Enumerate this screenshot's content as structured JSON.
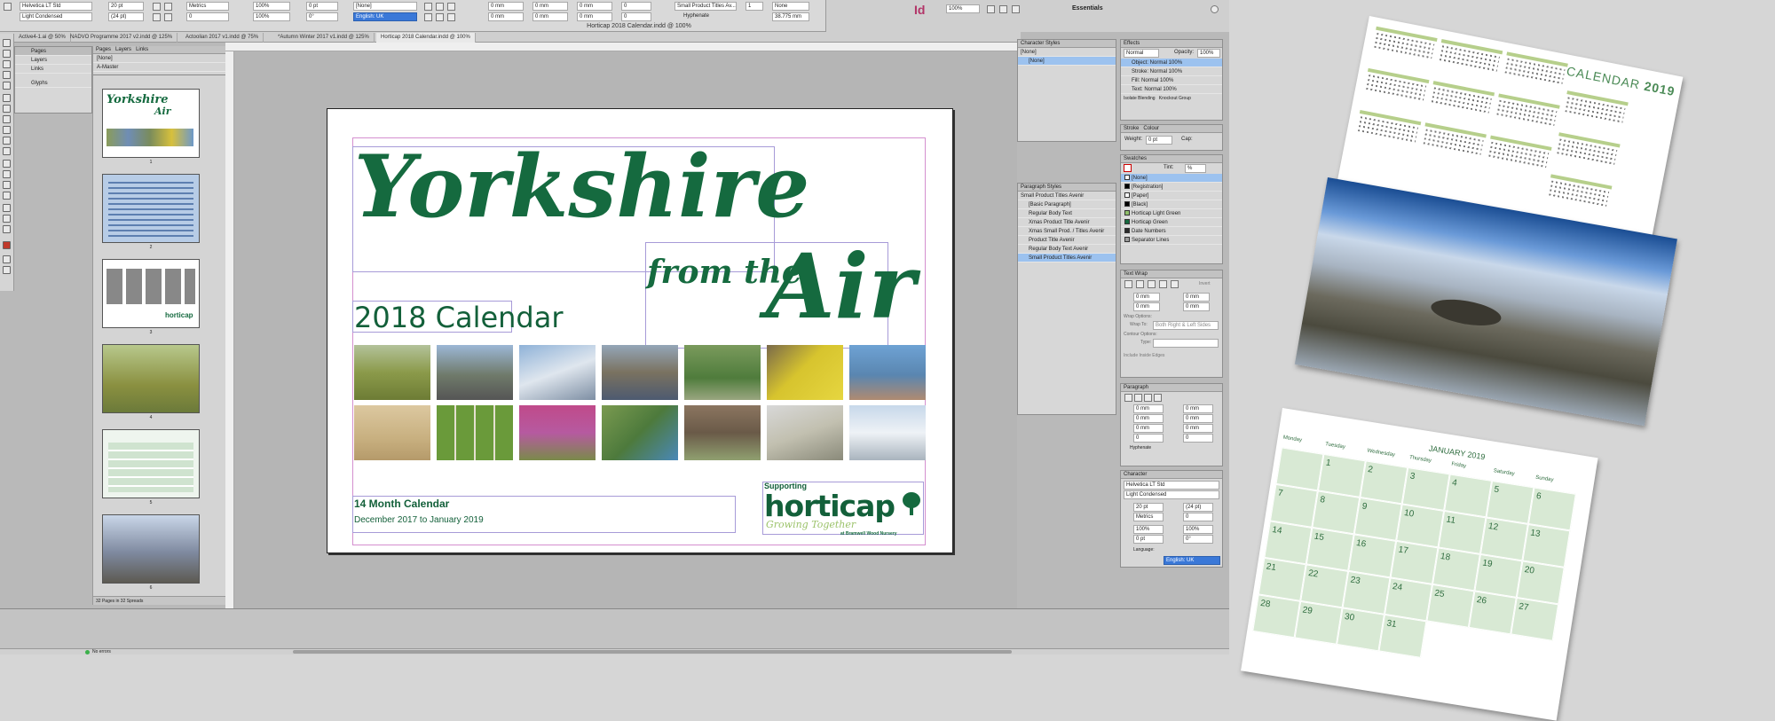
{
  "toolbar": {
    "font_family": "Helvetica LT Std",
    "font_style": "Light Condensed",
    "size": "20 pt",
    "leading": "(24 pt)",
    "tracking": "Metrics",
    "scale_h": "100%",
    "scale_v": "100%",
    "char_style": "[None]",
    "language": "English: UK",
    "paragraph_style": "Small Product Titles Av...",
    "hyphenate": "Hyphenate",
    "none": "None",
    "zoom": "100%",
    "workspace": "Essentials",
    "app_logo": "Id"
  },
  "window_title": "Horticap 2018 Calendar.indd @ 100%",
  "doc_tabs": [
    "Active4-1.ai @ 50%",
    "NADVO Programme 2017 v2.indd @ 125%",
    "Actoolian 2017 v1.indd @ 75%",
    "*Autumn Winter 2017 v1.indd @ 125%",
    "Horticap 2018 Calendar.indd @ 100%"
  ],
  "panels_left": {
    "items": [
      "Pages",
      "Layers",
      "Links",
      "Glyphs"
    ]
  },
  "pages_panel": {
    "tabs": [
      "Pages",
      "Layers",
      "Links"
    ],
    "none_label": "[None]",
    "master_label": "A-Master",
    "page_numbers": [
      "1",
      "2",
      "3",
      "4",
      "5",
      "6"
    ],
    "footer": "32 Pages in 32 Spreads"
  },
  "document": {
    "title_yorkshire": "Yorkshire",
    "title_from_the": "from the",
    "title_air": "Air",
    "subtitle": "2018 Calendar",
    "month_label": "14 Month Calendar",
    "date_range": "December 2017 to January 2019",
    "supporting": "Supporting",
    "logo": "horticap",
    "logo_tagline": "Growing Together",
    "logo_sub": "at Bramwell Wood Nursery"
  },
  "character_styles": {
    "title": "Character Styles",
    "rows": [
      "[None]",
      "[None]"
    ]
  },
  "paragraph_styles": {
    "title": "Paragraph Styles",
    "current": "Small Product Titles Avenir",
    "rows": [
      "[Basic Paragraph]",
      "Regular Body Text",
      "Xmas Product Title Avenir",
      "Xmas Small Prod. / Titles Avenir",
      "Product Title Avenir",
      "Regular Body Text Avenir",
      "Small Product Titles Avenir"
    ]
  },
  "effects": {
    "title": "Effects",
    "mode": "Normal",
    "opacity_label": "Opacity:",
    "opacity": "100%",
    "rows": [
      "Object: Normal 100%",
      "Stroke: Normal 100%",
      "Fill: Normal 100%",
      "Text: Normal 100%"
    ],
    "isolate": "Isolate Blending",
    "knockout": "Knockout Group"
  },
  "stroke": {
    "tabs": [
      "Stroke",
      "Colour"
    ],
    "weight_label": "Weight:",
    "weight": "0 pt",
    "cap_label": "Cap:"
  },
  "swatches": {
    "title": "Swatches",
    "tint_label": "Tint:",
    "tint": "%",
    "rows": [
      {
        "name": "[None]",
        "color": "#ffffff"
      },
      {
        "name": "[Registration]",
        "color": "#000000"
      },
      {
        "name": "[Paper]",
        "color": "#ffffff"
      },
      {
        "name": "[Black]",
        "color": "#000000"
      },
      {
        "name": "Horticap Light Green",
        "color": "#8fbf6a"
      },
      {
        "name": "Horticap Green",
        "color": "#156a3f"
      },
      {
        "name": "Date Numbers",
        "color": "#2a2a2a"
      },
      {
        "name": "Separator Lines",
        "color": "#9a9a9a"
      }
    ]
  },
  "text_wrap": {
    "title": "Text Wrap",
    "invert": "Invert",
    "value": "0 mm",
    "wrap_options": "Wrap Options:",
    "wrap_to_label": "Wrap To:",
    "wrap_to": "Both Right & Left Sides",
    "contour": "Contour Options:",
    "type_label": "Type:",
    "include_edges": "Include Inside Edges"
  },
  "paragraph_panel": {
    "title": "Paragraph",
    "value": "0 mm",
    "hyphenate": "Hyphenate"
  },
  "character_panel": {
    "title": "Character",
    "font": "Helvetica LT Std",
    "style": "Light Condensed",
    "size": "20 pt",
    "leading": "(24 pt)",
    "kerning": "Metrics",
    "tracking": "0",
    "scale_h": "100%",
    "scale_v": "100%",
    "baseline": "0 pt",
    "skew": "0°",
    "language_label": "Language:",
    "language": "English: UK"
  },
  "status": {
    "errors": "No errors"
  },
  "preview": {
    "calendar_title": "CALENDAR",
    "calendar_year": "2019",
    "logo": "horticap",
    "month": "JANUARY 2019",
    "days": [
      "Monday",
      "Tuesday",
      "Wednesday",
      "Thursday",
      "Friday",
      "Saturday",
      "Sunday"
    ],
    "dates": [
      "1",
      "2",
      "3",
      "4",
      "5",
      "6",
      "7",
      "8",
      "9",
      "10",
      "11",
      "12",
      "13",
      "14",
      "15",
      "16",
      "17",
      "18",
      "19",
      "20",
      "21",
      "22",
      "23",
      "24",
      "25",
      "26",
      "27",
      "28",
      "29",
      "30",
      "31"
    ]
  }
}
